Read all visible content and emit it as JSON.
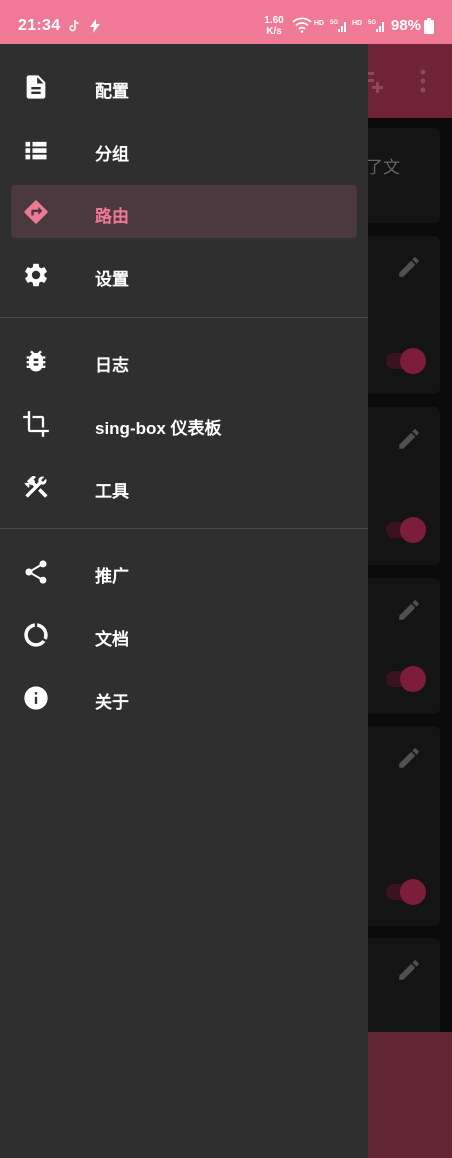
{
  "status_bar": {
    "time": "21:34",
    "network_speed_value": "1.60",
    "network_speed_unit": "K/s",
    "battery": "98%",
    "icons": [
      "tiktok-icon",
      "flash-icon",
      "wifi-icon",
      "hd-icon",
      "signal-5g-icon",
      "battery-icon"
    ]
  },
  "drawer": {
    "items": [
      {
        "label": "配置",
        "icon": "document-icon"
      },
      {
        "label": "分组",
        "icon": "list-icon"
      },
      {
        "label": "路由",
        "icon": "route-icon",
        "selected": true
      },
      {
        "label": "设置",
        "icon": "gear-icon"
      },
      {
        "label": "日志",
        "icon": "bug-icon"
      },
      {
        "label": "sing-box 仪表板",
        "icon": "crop-icon"
      },
      {
        "label": "工具",
        "icon": "tools-icon"
      },
      {
        "label": "推广",
        "icon": "share-icon"
      },
      {
        "label": "文档",
        "icon": "circle-notch-icon"
      },
      {
        "label": "关于",
        "icon": "info-icon"
      }
    ]
  },
  "background": {
    "partial_card_text": "了文"
  },
  "colors": {
    "accent": "#f07a96",
    "drawer_bg": "#2f2f2f",
    "selected_bg": "#4a3a3f"
  }
}
